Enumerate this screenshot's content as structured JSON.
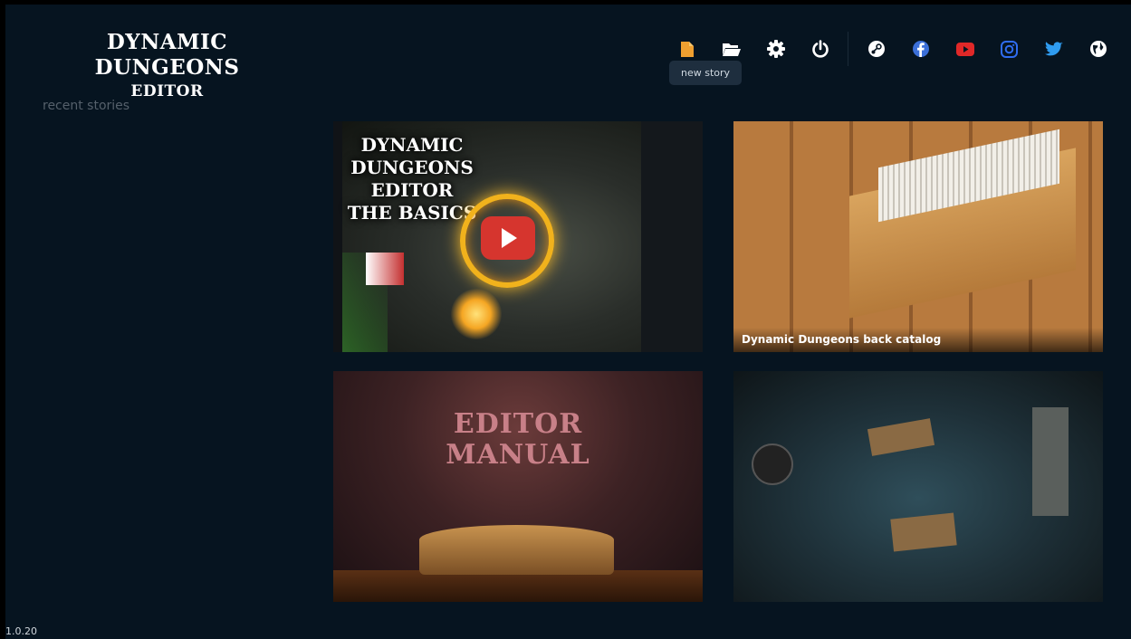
{
  "app": {
    "logo_line1": "DYNAMIC DUNGEONS",
    "logo_line2": "EDITOR",
    "version": "1.0.20"
  },
  "sidebar": {
    "recent_label": "recent stories"
  },
  "toolbar": {
    "tooltip": "new story",
    "buttons": [
      {
        "name": "new-story",
        "icon": "file-icon",
        "color": "#f0a030"
      },
      {
        "name": "open",
        "icon": "folder-open-icon",
        "color": "#ffffff"
      },
      {
        "name": "settings",
        "icon": "gear-icon",
        "color": "#ffffff"
      },
      {
        "name": "quit",
        "icon": "power-icon",
        "color": "#ffffff"
      },
      {
        "name": "steam",
        "icon": "steam-icon",
        "color": "#ffffff"
      },
      {
        "name": "facebook",
        "icon": "facebook-icon",
        "color": "#3b6fd8"
      },
      {
        "name": "youtube",
        "icon": "youtube-icon",
        "color": "#e02828"
      },
      {
        "name": "instagram",
        "icon": "instagram-icon",
        "color": "#2f6cf0"
      },
      {
        "name": "twitter",
        "icon": "twitter-icon",
        "color": "#2f9cf0"
      },
      {
        "name": "website",
        "icon": "globe-icon",
        "color": "#ffffff"
      }
    ]
  },
  "cards": {
    "basics": {
      "title_lines": [
        "DYNAMIC",
        "DUNGEONS",
        "EDITOR",
        "THE BASICS"
      ]
    },
    "back_catalog": {
      "caption": "Dynamic Dungeons back catalog"
    },
    "manual": {
      "title_lines": [
        "EDITOR",
        "MANUAL"
      ]
    }
  }
}
